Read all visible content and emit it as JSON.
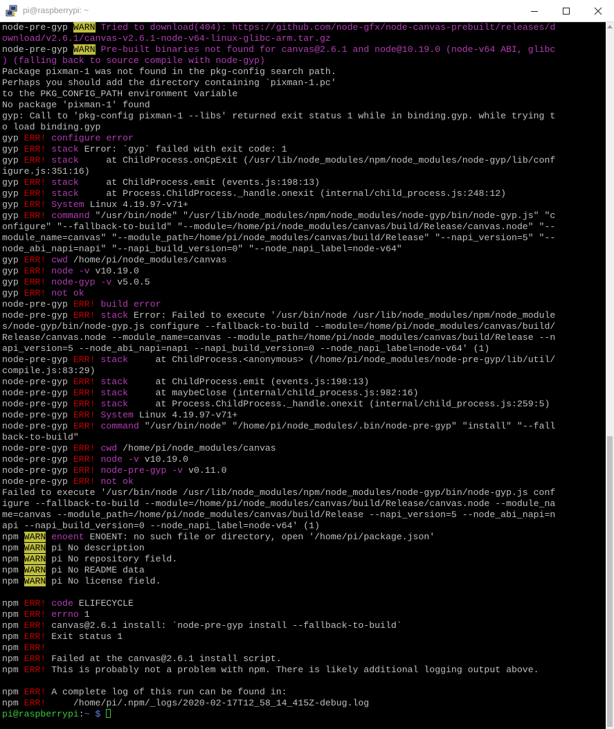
{
  "window": {
    "title": "pi@raspberrypi: ~",
    "icons": {
      "app": "putty-icon",
      "minimize": "minimize-icon",
      "maximize": "maximize-icon",
      "close": "close-icon"
    }
  },
  "colors": {
    "background": "#000000",
    "text": "#c0c0c0",
    "magenta": "#b43cb4",
    "warn_bg": "#c0c040",
    "err": "#c40000",
    "green": "#3cc83c",
    "blue": "#5f7fe8"
  },
  "terminal": {
    "lines": [
      [
        {
          "t": "node-pre-gyp "
        },
        {
          "t": "WARN",
          "c": "wb"
        },
        {
          "t": " Tried to download(404): https://github.com/node-gfx/node-canvas-prebuilt/releases/d",
          "c": "m"
        }
      ],
      [
        {
          "t": "ownload/v2.6.1/canvas-v2.6.1-node-v64-linux-glibc-arm.tar.gz",
          "c": "m"
        }
      ],
      [
        {
          "t": "node-pre-gyp "
        },
        {
          "t": "WARN",
          "c": "wb"
        },
        {
          "t": " Pre-built binaries not found for canvas@2.6.1 and node@10.19.0 (node-v64 ABI, glibc",
          "c": "m"
        }
      ],
      [
        {
          "t": ") (falling back to source compile with node-gyp)",
          "c": "m"
        }
      ],
      [
        {
          "t": "Package pixman-1 was not found in the pkg-config search path."
        }
      ],
      [
        {
          "t": "Perhaps you should add the directory containing `pixman-1.pc'"
        }
      ],
      [
        {
          "t": "to the PKG_CONFIG_PATH environment variable"
        }
      ],
      [
        {
          "t": "No package 'pixman-1' found"
        }
      ],
      [
        {
          "t": "gyp: Call to 'pkg-config pixman-1 --libs' returned exit status 1 while in binding.gyp. while trying t"
        }
      ],
      [
        {
          "t": "o load binding.gyp"
        }
      ],
      [
        {
          "t": "gyp "
        },
        {
          "t": "ERR!",
          "c": "r"
        },
        {
          "t": " "
        },
        {
          "t": "configure error",
          "c": "m"
        }
      ],
      [
        {
          "t": "gyp "
        },
        {
          "t": "ERR!",
          "c": "r"
        },
        {
          "t": " "
        },
        {
          "t": "stack",
          "c": "m"
        },
        {
          "t": " Error: `gyp` failed with exit code: 1"
        }
      ],
      [
        {
          "t": "gyp "
        },
        {
          "t": "ERR!",
          "c": "r"
        },
        {
          "t": " "
        },
        {
          "t": "stack",
          "c": "m"
        },
        {
          "t": "     at ChildProcess.onCpExit (/usr/lib/node_modules/npm/node_modules/node-gyp/lib/conf"
        }
      ],
      [
        {
          "t": "igure.js:351:16)"
        }
      ],
      [
        {
          "t": "gyp "
        },
        {
          "t": "ERR!",
          "c": "r"
        },
        {
          "t": " "
        },
        {
          "t": "stack",
          "c": "m"
        },
        {
          "t": "     at ChildProcess.emit (events.js:198:13)"
        }
      ],
      [
        {
          "t": "gyp "
        },
        {
          "t": "ERR!",
          "c": "r"
        },
        {
          "t": " "
        },
        {
          "t": "stack",
          "c": "m"
        },
        {
          "t": "     at Process.ChildProcess._handle.onexit (internal/child_process.js:248:12)"
        }
      ],
      [
        {
          "t": "gyp "
        },
        {
          "t": "ERR!",
          "c": "r"
        },
        {
          "t": " "
        },
        {
          "t": "System",
          "c": "m"
        },
        {
          "t": " Linux 4.19.97-v71+"
        }
      ],
      [
        {
          "t": "gyp "
        },
        {
          "t": "ERR!",
          "c": "r"
        },
        {
          "t": " "
        },
        {
          "t": "command",
          "c": "m"
        },
        {
          "t": " \"/usr/bin/node\" \"/usr/lib/node_modules/npm/node_modules/node-gyp/bin/node-gyp.js\" \"c"
        }
      ],
      [
        {
          "t": "onfigure\" \"--fallback-to-build\" \"--module=/home/pi/node_modules/canvas/build/Release/canvas.node\" \"--"
        }
      ],
      [
        {
          "t": "module_name=canvas\" \"--module_path=/home/pi/node_modules/canvas/build/Release\" \"--napi_version=5\" \"--"
        }
      ],
      [
        {
          "t": "node_abi_napi=napi\" \"--napi_build_version=0\" \"--node_napi_label=node-v64\""
        }
      ],
      [
        {
          "t": "gyp "
        },
        {
          "t": "ERR!",
          "c": "r"
        },
        {
          "t": " "
        },
        {
          "t": "cwd",
          "c": "m"
        },
        {
          "t": " /home/pi/node_modules/canvas"
        }
      ],
      [
        {
          "t": "gyp "
        },
        {
          "t": "ERR!",
          "c": "r"
        },
        {
          "t": " "
        },
        {
          "t": "node -v",
          "c": "m"
        },
        {
          "t": " v10.19.0"
        }
      ],
      [
        {
          "t": "gyp "
        },
        {
          "t": "ERR!",
          "c": "r"
        },
        {
          "t": " "
        },
        {
          "t": "node-gyp -v",
          "c": "m"
        },
        {
          "t": " v5.0.5"
        }
      ],
      [
        {
          "t": "gyp "
        },
        {
          "t": "ERR!",
          "c": "r"
        },
        {
          "t": " "
        },
        {
          "t": "not ok",
          "c": "m"
        }
      ],
      [
        {
          "t": "node-pre-gyp "
        },
        {
          "t": "ERR!",
          "c": "r"
        },
        {
          "t": " "
        },
        {
          "t": "build error",
          "c": "m"
        }
      ],
      [
        {
          "t": "node-pre-gyp "
        },
        {
          "t": "ERR!",
          "c": "r"
        },
        {
          "t": " "
        },
        {
          "t": "stack",
          "c": "m"
        },
        {
          "t": " Error: Failed to execute '/usr/bin/node /usr/lib/node_modules/npm/node_module"
        }
      ],
      [
        {
          "t": "s/node-gyp/bin/node-gyp.js configure --fallback-to-build --module=/home/pi/node_modules/canvas/build/"
        }
      ],
      [
        {
          "t": "Release/canvas.node --module_name=canvas --module_path=/home/pi/node_modules/canvas/build/Release --n"
        }
      ],
      [
        {
          "t": "api_version=5 --node_abi_napi=napi --napi_build_version=0 --node_napi_label=node-v64' (1)"
        }
      ],
      [
        {
          "t": "node-pre-gyp "
        },
        {
          "t": "ERR!",
          "c": "r"
        },
        {
          "t": " "
        },
        {
          "t": "stack",
          "c": "m"
        },
        {
          "t": "     at ChildProcess.<anonymous> (/home/pi/node_modules/node-pre-gyp/lib/util/"
        }
      ],
      [
        {
          "t": "compile.js:83:29)"
        }
      ],
      [
        {
          "t": "node-pre-gyp "
        },
        {
          "t": "ERR!",
          "c": "r"
        },
        {
          "t": " "
        },
        {
          "t": "stack",
          "c": "m"
        },
        {
          "t": "     at ChildProcess.emit (events.js:198:13)"
        }
      ],
      [
        {
          "t": "node-pre-gyp "
        },
        {
          "t": "ERR!",
          "c": "r"
        },
        {
          "t": " "
        },
        {
          "t": "stack",
          "c": "m"
        },
        {
          "t": "     at maybeClose (internal/child_process.js:982:16)"
        }
      ],
      [
        {
          "t": "node-pre-gyp "
        },
        {
          "t": "ERR!",
          "c": "r"
        },
        {
          "t": " "
        },
        {
          "t": "stack",
          "c": "m"
        },
        {
          "t": "     at Process.ChildProcess._handle.onexit (internal/child_process.js:259:5)"
        }
      ],
      [
        {
          "t": "node-pre-gyp "
        },
        {
          "t": "ERR!",
          "c": "r"
        },
        {
          "t": " "
        },
        {
          "t": "System",
          "c": "m"
        },
        {
          "t": " Linux 4.19.97-v71+"
        }
      ],
      [
        {
          "t": "node-pre-gyp "
        },
        {
          "t": "ERR!",
          "c": "r"
        },
        {
          "t": " "
        },
        {
          "t": "command",
          "c": "m"
        },
        {
          "t": " \"/usr/bin/node\" \"/home/pi/node_modules/.bin/node-pre-gyp\" \"install\" \"--fall"
        }
      ],
      [
        {
          "t": "back-to-build\""
        }
      ],
      [
        {
          "t": "node-pre-gyp "
        },
        {
          "t": "ERR!",
          "c": "r"
        },
        {
          "t": " "
        },
        {
          "t": "cwd",
          "c": "m"
        },
        {
          "t": " /home/pi/node_modules/canvas"
        }
      ],
      [
        {
          "t": "node-pre-gyp "
        },
        {
          "t": "ERR!",
          "c": "r"
        },
        {
          "t": " "
        },
        {
          "t": "node -v",
          "c": "m"
        },
        {
          "t": " v10.19.0"
        }
      ],
      [
        {
          "t": "node-pre-gyp "
        },
        {
          "t": "ERR!",
          "c": "r"
        },
        {
          "t": " "
        },
        {
          "t": "node-pre-gyp -v",
          "c": "m"
        },
        {
          "t": " v0.11.0"
        }
      ],
      [
        {
          "t": "node-pre-gyp "
        },
        {
          "t": "ERR!",
          "c": "r"
        },
        {
          "t": " "
        },
        {
          "t": "not ok",
          "c": "m"
        }
      ],
      [
        {
          "t": "Failed to execute '/usr/bin/node /usr/lib/node_modules/npm/node_modules/node-gyp/bin/node-gyp.js conf"
        }
      ],
      [
        {
          "t": "igure --fallback-to-build --module=/home/pi/node_modules/canvas/build/Release/canvas.node --module_na"
        }
      ],
      [
        {
          "t": "me=canvas --module_path=/home/pi/node_modules/canvas/build/Release --napi_version=5 --node_abi_napi=n"
        }
      ],
      [
        {
          "t": "api --napi_build_version=0 --node_napi_label=node-v64' (1)"
        }
      ],
      [
        {
          "t": "npm "
        },
        {
          "t": "WARN",
          "c": "wb"
        },
        {
          "t": " "
        },
        {
          "t": "enoent",
          "c": "m"
        },
        {
          "t": " ENOENT: no such file or directory, open '/home/pi/package.json'"
        }
      ],
      [
        {
          "t": "npm "
        },
        {
          "t": "WARN",
          "c": "wb"
        },
        {
          "t": " pi No description"
        }
      ],
      [
        {
          "t": "npm "
        },
        {
          "t": "WARN",
          "c": "wb"
        },
        {
          "t": " pi No repository field."
        }
      ],
      [
        {
          "t": "npm "
        },
        {
          "t": "WARN",
          "c": "wb"
        },
        {
          "t": " pi No README data"
        }
      ],
      [
        {
          "t": "npm "
        },
        {
          "t": "WARN",
          "c": "wb"
        },
        {
          "t": " pi No license field."
        }
      ],
      [
        {
          "t": ""
        }
      ],
      [
        {
          "t": "npm "
        },
        {
          "t": "ERR!",
          "c": "r"
        },
        {
          "t": " "
        },
        {
          "t": "code",
          "c": "m"
        },
        {
          "t": " ELIFECYCLE"
        }
      ],
      [
        {
          "t": "npm "
        },
        {
          "t": "ERR!",
          "c": "r"
        },
        {
          "t": " "
        },
        {
          "t": "errno",
          "c": "m"
        },
        {
          "t": " 1"
        }
      ],
      [
        {
          "t": "npm "
        },
        {
          "t": "ERR!",
          "c": "r"
        },
        {
          "t": " canvas@2.6.1 install: `node-pre-gyp install --fallback-to-build`"
        }
      ],
      [
        {
          "t": "npm "
        },
        {
          "t": "ERR!",
          "c": "r"
        },
        {
          "t": " Exit status 1"
        }
      ],
      [
        {
          "t": "npm "
        },
        {
          "t": "ERR!",
          "c": "r"
        }
      ],
      [
        {
          "t": "npm "
        },
        {
          "t": "ERR!",
          "c": "r"
        },
        {
          "t": " Failed at the canvas@2.6.1 install script."
        }
      ],
      [
        {
          "t": "npm "
        },
        {
          "t": "ERR!",
          "c": "r"
        },
        {
          "t": " This is probably not a problem with npm. There is likely additional logging output above."
        }
      ],
      [
        {
          "t": ""
        }
      ],
      [
        {
          "t": "npm "
        },
        {
          "t": "ERR!",
          "c": "r"
        },
        {
          "t": " A complete log of this run can be found in:"
        }
      ],
      [
        {
          "t": "npm "
        },
        {
          "t": "ERR!",
          "c": "r"
        },
        {
          "t": "     /home/pi/.npm/_logs/2020-02-17T12_58_14_415Z-debug.log"
        }
      ]
    ],
    "prompt": {
      "user_host": "pi@raspberrypi",
      "sep": ":",
      "path": "~",
      "symbol": " $ "
    }
  }
}
